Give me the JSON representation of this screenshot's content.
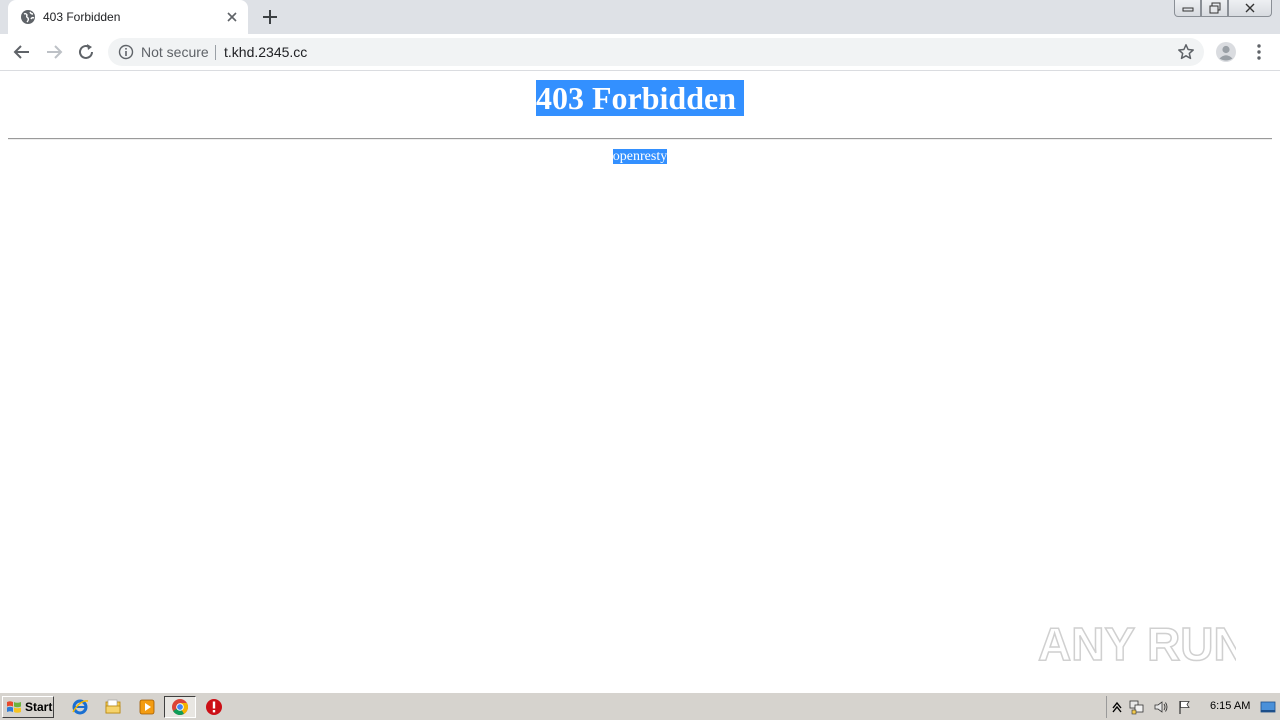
{
  "browser": {
    "tab": {
      "title": "403 Forbidden"
    },
    "omnibox": {
      "security_label": "Not secure",
      "url": "t.khd.2345.cc"
    }
  },
  "page": {
    "heading": "403 Forbidden",
    "footer": "openresty"
  },
  "watermark": {
    "text": "ANY RUN"
  },
  "taskbar": {
    "start_label": "Start",
    "clock": "6:15 AM"
  },
  "colors": {
    "selection": "#3390ff",
    "tabstrip": "#dee1e6",
    "taskbar": "#d6d3ce"
  }
}
